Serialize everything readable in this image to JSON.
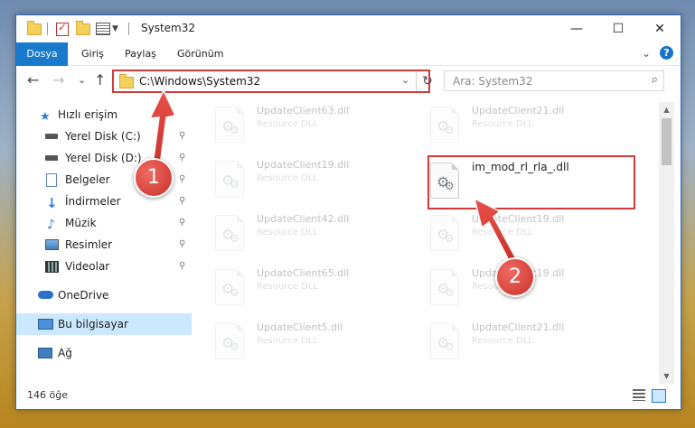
{
  "window": {
    "title": "System32",
    "controls": {
      "minimize": "—",
      "maximize": "☐",
      "close": "✕"
    }
  },
  "ribbon": {
    "tabs": [
      "Dosya",
      "Giriş",
      "Paylaş",
      "Görünüm"
    ],
    "collapse": "⌄",
    "help": "?"
  },
  "nav": {
    "back": "←",
    "forward": "→",
    "recent": "⌄",
    "up": "↑",
    "address": "C:\\Windows\\System32",
    "address_dropdown": "⌄",
    "refresh": "↻",
    "search_placeholder": "Ara: System32",
    "search_icon": "magnifier-icon"
  },
  "sidebar": {
    "items": [
      {
        "label": "Hızlı erişim",
        "icon": "star-icon",
        "pinned": false
      },
      {
        "label": "Yerel Disk (C:)",
        "icon": "drive-icon",
        "pinned": true
      },
      {
        "label": "Yerel Disk (D:)",
        "icon": "drive-icon",
        "pinned": true
      },
      {
        "label": "Belgeler",
        "icon": "documents-icon",
        "pinned": true
      },
      {
        "label": "İndirmeler",
        "icon": "download-icon",
        "pinned": true
      },
      {
        "label": "Müzik",
        "icon": "music-icon",
        "pinned": true
      },
      {
        "label": "Resimler",
        "icon": "pictures-icon",
        "pinned": true
      },
      {
        "label": "Videolar",
        "icon": "videos-icon",
        "pinned": true
      },
      {
        "label": "OneDrive",
        "icon": "cloud-icon",
        "pinned": false
      },
      {
        "label": "Bu bilgisayar",
        "icon": "computer-icon",
        "pinned": false,
        "selected": true
      },
      {
        "label": "Ağ",
        "icon": "network-icon",
        "pinned": false
      }
    ],
    "pin_glyph": "📌"
  },
  "files": [
    {
      "name": "UpdateClient63.dll",
      "type": "Resource DLL"
    },
    {
      "name": "UpdateClient21.dll",
      "type": "Resource DLL"
    },
    {
      "name": "UpdateClient19.dll",
      "type": "Resource DLL"
    },
    {
      "name": "im_mod_rl_rla_.dll",
      "type": "",
      "highlighted": true
    },
    {
      "name": "UpdateClient42.dll",
      "type": "Resource DLL"
    },
    {
      "name": "UpdateClient19.dll",
      "type": "Resource DLL"
    },
    {
      "name": "UpdateClient65.dll",
      "type": "Resource DLL"
    },
    {
      "name": "UpdateClient19.dll",
      "type": "Resource DLL"
    },
    {
      "name": "UpdateClient5.dll",
      "type": "Resource DLL"
    },
    {
      "name": "UpdateClient21.dll",
      "type": "Resource DLL"
    }
  ],
  "status": {
    "count": "146 öğe"
  },
  "annotations": {
    "step1": "1",
    "step2": "2"
  },
  "colors": {
    "accent": "#1979ca",
    "highlight": "#d33a3a",
    "selected": "#cce8ff"
  }
}
